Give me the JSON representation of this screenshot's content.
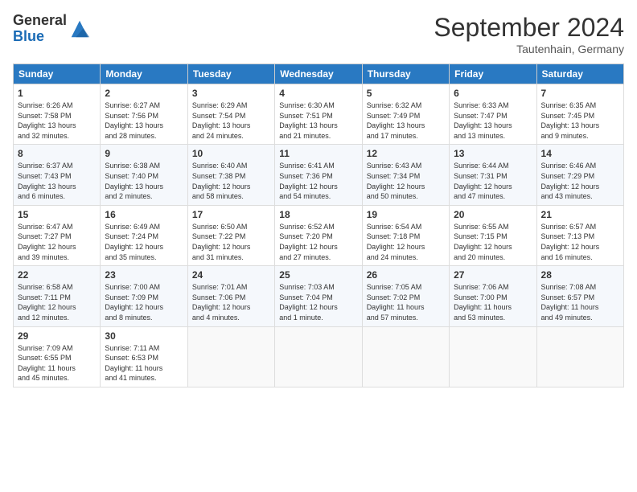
{
  "header": {
    "logo_line1": "General",
    "logo_line2": "Blue",
    "month_title": "September 2024",
    "location": "Tautenhain, Germany"
  },
  "days_of_week": [
    "Sunday",
    "Monday",
    "Tuesday",
    "Wednesday",
    "Thursday",
    "Friday",
    "Saturday"
  ],
  "weeks": [
    [
      {
        "day": 1,
        "lines": [
          "Sunrise: 6:26 AM",
          "Sunset: 7:58 PM",
          "Daylight: 13 hours",
          "and 32 minutes."
        ]
      },
      {
        "day": 2,
        "lines": [
          "Sunrise: 6:27 AM",
          "Sunset: 7:56 PM",
          "Daylight: 13 hours",
          "and 28 minutes."
        ]
      },
      {
        "day": 3,
        "lines": [
          "Sunrise: 6:29 AM",
          "Sunset: 7:54 PM",
          "Daylight: 13 hours",
          "and 24 minutes."
        ]
      },
      {
        "day": 4,
        "lines": [
          "Sunrise: 6:30 AM",
          "Sunset: 7:51 PM",
          "Daylight: 13 hours",
          "and 21 minutes."
        ]
      },
      {
        "day": 5,
        "lines": [
          "Sunrise: 6:32 AM",
          "Sunset: 7:49 PM",
          "Daylight: 13 hours",
          "and 17 minutes."
        ]
      },
      {
        "day": 6,
        "lines": [
          "Sunrise: 6:33 AM",
          "Sunset: 7:47 PM",
          "Daylight: 13 hours",
          "and 13 minutes."
        ]
      },
      {
        "day": 7,
        "lines": [
          "Sunrise: 6:35 AM",
          "Sunset: 7:45 PM",
          "Daylight: 13 hours",
          "and 9 minutes."
        ]
      }
    ],
    [
      {
        "day": 8,
        "lines": [
          "Sunrise: 6:37 AM",
          "Sunset: 7:43 PM",
          "Daylight: 13 hours",
          "and 6 minutes."
        ]
      },
      {
        "day": 9,
        "lines": [
          "Sunrise: 6:38 AM",
          "Sunset: 7:40 PM",
          "Daylight: 13 hours",
          "and 2 minutes."
        ]
      },
      {
        "day": 10,
        "lines": [
          "Sunrise: 6:40 AM",
          "Sunset: 7:38 PM",
          "Daylight: 12 hours",
          "and 58 minutes."
        ]
      },
      {
        "day": 11,
        "lines": [
          "Sunrise: 6:41 AM",
          "Sunset: 7:36 PM",
          "Daylight: 12 hours",
          "and 54 minutes."
        ]
      },
      {
        "day": 12,
        "lines": [
          "Sunrise: 6:43 AM",
          "Sunset: 7:34 PM",
          "Daylight: 12 hours",
          "and 50 minutes."
        ]
      },
      {
        "day": 13,
        "lines": [
          "Sunrise: 6:44 AM",
          "Sunset: 7:31 PM",
          "Daylight: 12 hours",
          "and 47 minutes."
        ]
      },
      {
        "day": 14,
        "lines": [
          "Sunrise: 6:46 AM",
          "Sunset: 7:29 PM",
          "Daylight: 12 hours",
          "and 43 minutes."
        ]
      }
    ],
    [
      {
        "day": 15,
        "lines": [
          "Sunrise: 6:47 AM",
          "Sunset: 7:27 PM",
          "Daylight: 12 hours",
          "and 39 minutes."
        ]
      },
      {
        "day": 16,
        "lines": [
          "Sunrise: 6:49 AM",
          "Sunset: 7:24 PM",
          "Daylight: 12 hours",
          "and 35 minutes."
        ]
      },
      {
        "day": 17,
        "lines": [
          "Sunrise: 6:50 AM",
          "Sunset: 7:22 PM",
          "Daylight: 12 hours",
          "and 31 minutes."
        ]
      },
      {
        "day": 18,
        "lines": [
          "Sunrise: 6:52 AM",
          "Sunset: 7:20 PM",
          "Daylight: 12 hours",
          "and 27 minutes."
        ]
      },
      {
        "day": 19,
        "lines": [
          "Sunrise: 6:54 AM",
          "Sunset: 7:18 PM",
          "Daylight: 12 hours",
          "and 24 minutes."
        ]
      },
      {
        "day": 20,
        "lines": [
          "Sunrise: 6:55 AM",
          "Sunset: 7:15 PM",
          "Daylight: 12 hours",
          "and 20 minutes."
        ]
      },
      {
        "day": 21,
        "lines": [
          "Sunrise: 6:57 AM",
          "Sunset: 7:13 PM",
          "Daylight: 12 hours",
          "and 16 minutes."
        ]
      }
    ],
    [
      {
        "day": 22,
        "lines": [
          "Sunrise: 6:58 AM",
          "Sunset: 7:11 PM",
          "Daylight: 12 hours",
          "and 12 minutes."
        ]
      },
      {
        "day": 23,
        "lines": [
          "Sunrise: 7:00 AM",
          "Sunset: 7:09 PM",
          "Daylight: 12 hours",
          "and 8 minutes."
        ]
      },
      {
        "day": 24,
        "lines": [
          "Sunrise: 7:01 AM",
          "Sunset: 7:06 PM",
          "Daylight: 12 hours",
          "and 4 minutes."
        ]
      },
      {
        "day": 25,
        "lines": [
          "Sunrise: 7:03 AM",
          "Sunset: 7:04 PM",
          "Daylight: 12 hours",
          "and 1 minute."
        ]
      },
      {
        "day": 26,
        "lines": [
          "Sunrise: 7:05 AM",
          "Sunset: 7:02 PM",
          "Daylight: 11 hours",
          "and 57 minutes."
        ]
      },
      {
        "day": 27,
        "lines": [
          "Sunrise: 7:06 AM",
          "Sunset: 7:00 PM",
          "Daylight: 11 hours",
          "and 53 minutes."
        ]
      },
      {
        "day": 28,
        "lines": [
          "Sunrise: 7:08 AM",
          "Sunset: 6:57 PM",
          "Daylight: 11 hours",
          "and 49 minutes."
        ]
      }
    ],
    [
      {
        "day": 29,
        "lines": [
          "Sunrise: 7:09 AM",
          "Sunset: 6:55 PM",
          "Daylight: 11 hours",
          "and 45 minutes."
        ]
      },
      {
        "day": 30,
        "lines": [
          "Sunrise: 7:11 AM",
          "Sunset: 6:53 PM",
          "Daylight: 11 hours",
          "and 41 minutes."
        ]
      },
      null,
      null,
      null,
      null,
      null
    ]
  ]
}
